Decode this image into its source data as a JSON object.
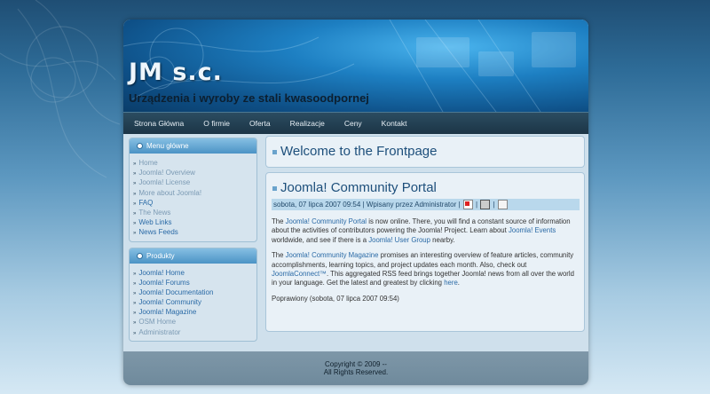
{
  "header": {
    "title": "JM s.c.",
    "slogan": "Urządzenia i wyroby ze stali kwasoodpornej"
  },
  "nav": [
    "Strona Główna",
    "O firmie",
    "Oferta",
    "Realizacje",
    "Ceny",
    "Kontakt"
  ],
  "modules": [
    {
      "title": "Menu główne",
      "items": [
        {
          "label": "Home",
          "visited": true
        },
        {
          "label": "Joomla! Overview",
          "visited": true
        },
        {
          "label": "Joomla! License",
          "visited": true
        },
        {
          "label": "More about Joomla!",
          "visited": true
        },
        {
          "label": "FAQ",
          "visited": false
        },
        {
          "label": "The News",
          "visited": true
        },
        {
          "label": "Web Links",
          "visited": false
        },
        {
          "label": "News Feeds",
          "visited": false
        }
      ]
    },
    {
      "title": "Produkty",
      "items": [
        {
          "label": "Joomla! Home",
          "visited": false
        },
        {
          "label": "Joomla! Forums",
          "visited": false
        },
        {
          "label": "Joomla! Documentation",
          "visited": false
        },
        {
          "label": "Joomla! Community",
          "visited": false
        },
        {
          "label": "Joomla! Magazine",
          "visited": false
        },
        {
          "label": "OSM Home",
          "visited": true
        },
        {
          "label": "Administrator",
          "visited": true
        }
      ]
    }
  ],
  "welcome": {
    "heading": "Welcome to the Frontpage"
  },
  "article": {
    "title": "Joomla! Community Portal",
    "date": "sobota, 07 lipca 2007 09:54",
    "author": "Wpisany przez Administrator",
    "sep": "|",
    "p1": {
      "t1": "The ",
      "l1": "Joomla! Community Portal",
      "t2": " is now online. There, you will find a constant source of information about the activities of contributors powering the Joomla! Project. Learn about ",
      "l2": "Joomla! Events",
      "t3": " worldwide, and see if there is a ",
      "l3": "Joomla! User Group",
      "t4": " nearby."
    },
    "p2": {
      "t1": "The ",
      "l1": "Joomla! Community Magazine",
      "t2": " promises an interesting overview of feature articles, community accomplishments, learning topics, and project updates each month. Also, check out ",
      "l2": "JoomlaConnect™",
      "t3": ". This aggregated RSS feed brings together Joomla! news from all over the world in your language. Get the latest and greatest by clicking ",
      "l3": "here",
      "t4": "."
    },
    "modified": "Poprawiony (sobota, 07 lipca 2007 09:54)"
  },
  "footer": {
    "copyright": "Copyright © 2009 --",
    "rights": "All Rights Reserved."
  },
  "colors": {
    "link": "#2a6aa6",
    "heading": "#1d4f7b",
    "nav_bg": "#1c3546",
    "footer_bg": "#7e97a8"
  }
}
